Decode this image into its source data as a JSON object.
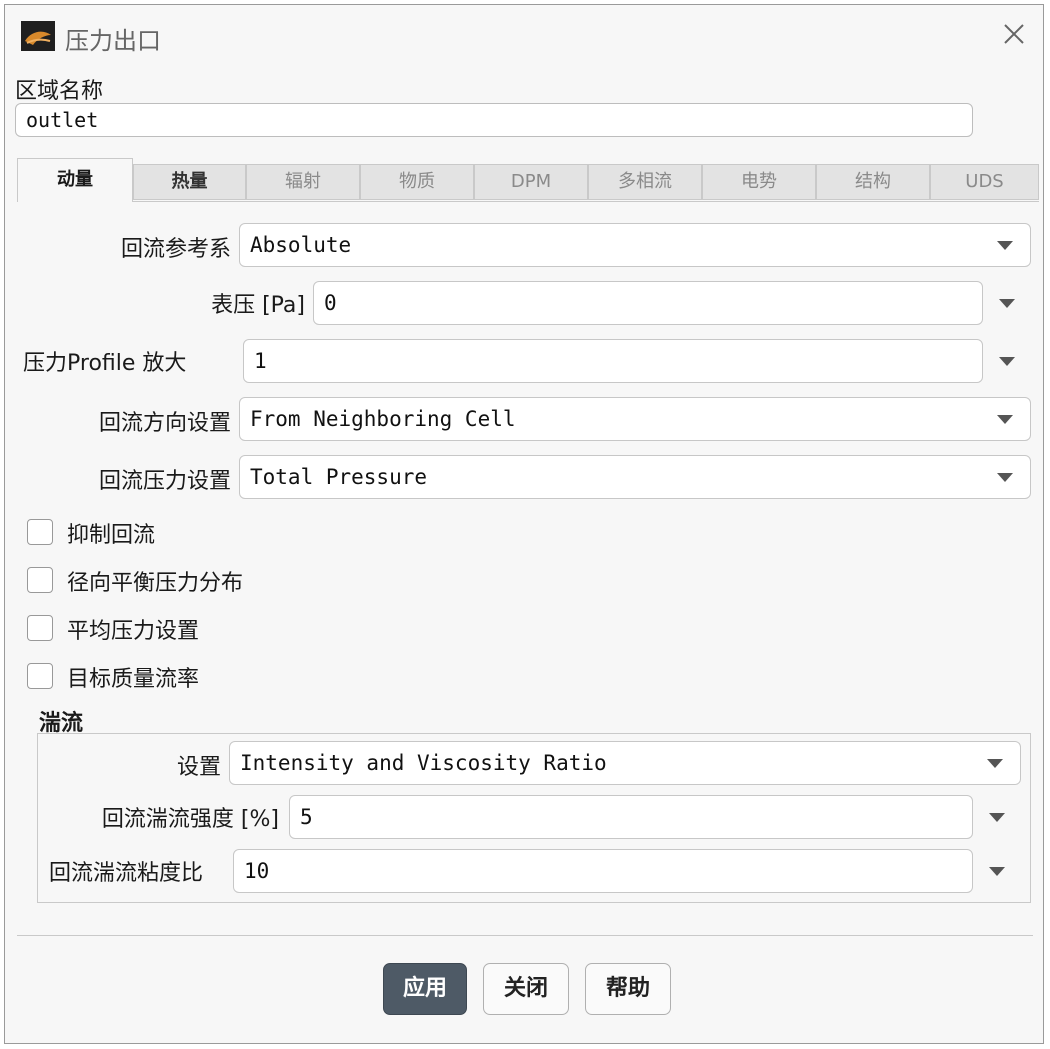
{
  "window": {
    "title": "压力出口",
    "app_icon": "fluent-logo-icon",
    "close_icon": "close-icon"
  },
  "zone": {
    "label": "区域名称",
    "value": "outlet"
  },
  "tabs": [
    {
      "label": "动量",
      "state": "active"
    },
    {
      "label": "热量",
      "state": "enabled"
    },
    {
      "label": "辐射",
      "state": "disabled"
    },
    {
      "label": "物质",
      "state": "disabled"
    },
    {
      "label": "DPM",
      "state": "disabled"
    },
    {
      "label": "多相流",
      "state": "disabled"
    },
    {
      "label": "电势",
      "state": "disabled"
    },
    {
      "label": "结构",
      "state": "disabled"
    },
    {
      "label": "UDS",
      "state": "disabled"
    }
  ],
  "momentum": {
    "backflow_ref": {
      "label": "回流参考系",
      "value": "Absolute"
    },
    "gauge_pressure": {
      "label": "表压 [Pa]",
      "value": "0"
    },
    "profile_multiplier": {
      "label": "压力Profile 放大",
      "value": "1"
    },
    "backflow_direction": {
      "label": "回流方向设置",
      "value": "From Neighboring Cell"
    },
    "backflow_pressure": {
      "label": "回流压力设置",
      "value": "Total Pressure"
    },
    "checkboxes": [
      {
        "label": "抑制回流",
        "checked": false
      },
      {
        "label": "径向平衡压力分布",
        "checked": false
      },
      {
        "label": "平均压力设置",
        "checked": false
      },
      {
        "label": "目标质量流率",
        "checked": false
      }
    ]
  },
  "turbulence": {
    "title": "湍流",
    "method": {
      "label": "设置",
      "value": "Intensity and Viscosity Ratio"
    },
    "intensity": {
      "label": "回流湍流强度 [%]",
      "value": "5"
    },
    "viscosity_ratio": {
      "label": "回流湍流粘度比",
      "value": "10"
    }
  },
  "buttons": {
    "apply": "应用",
    "close": "关闭",
    "help": "帮助"
  },
  "colors": {
    "primary_button": "#4e5a66",
    "dialog_bg": "#f7f7f7"
  }
}
